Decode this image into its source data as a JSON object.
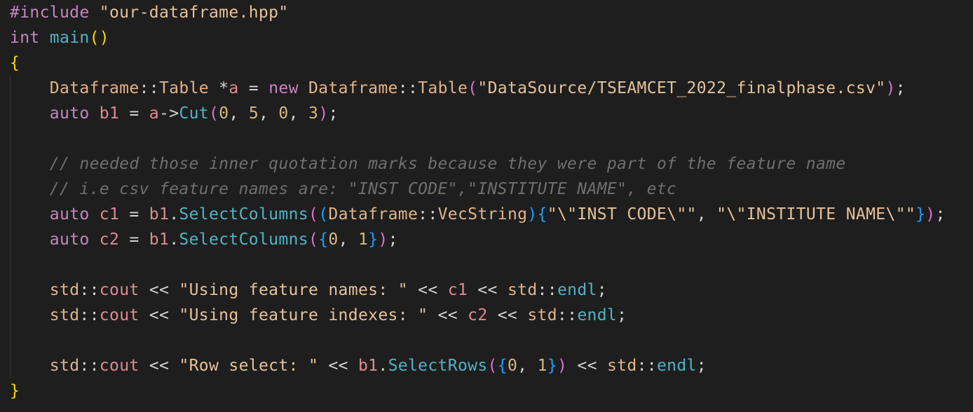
{
  "colors": {
    "background": "#1e1e1e",
    "default": "#d4d4d4",
    "keyword": "#c586c0",
    "type": "#4fb4c6",
    "function": "#4fb4c6",
    "string": "#e6c29a",
    "number": "#d7ba7d",
    "variable": "#e08a93",
    "comment": "#6f6f6f",
    "class": "#e2b387",
    "bracket1": "#ffd700",
    "bracket2": "#da70d6",
    "bracket3": "#179fff"
  },
  "lines": [
    [
      [
        "#include ",
        "keyword"
      ],
      [
        "\"our-dataframe.hpp\"",
        "string"
      ]
    ],
    [
      [
        "int ",
        "keyword"
      ],
      [
        "main",
        "function"
      ],
      [
        "()",
        "bracket1"
      ]
    ],
    [
      [
        "{",
        "bracket1"
      ]
    ],
    [
      [
        "    ",
        "default"
      ],
      [
        "Dataframe",
        "class"
      ],
      [
        "::",
        "default"
      ],
      [
        "Table",
        "class"
      ],
      [
        " *",
        "default"
      ],
      [
        "a",
        "variable"
      ],
      [
        " = ",
        "default"
      ],
      [
        "new ",
        "keyword"
      ],
      [
        "Dataframe",
        "class"
      ],
      [
        "::",
        "default"
      ],
      [
        "Table",
        "class"
      ],
      [
        "(",
        "bracket2"
      ],
      [
        "\"DataSource/TSEAMCET_2022_finalphase.csv\"",
        "string"
      ],
      [
        ")",
        "bracket2"
      ],
      [
        ";",
        "default"
      ]
    ],
    [
      [
        "    ",
        "default"
      ],
      [
        "auto ",
        "keyword"
      ],
      [
        "b1",
        "variable"
      ],
      [
        " = ",
        "default"
      ],
      [
        "a",
        "variable"
      ],
      [
        "->",
        "default"
      ],
      [
        "Cut",
        "function"
      ],
      [
        "(",
        "bracket2"
      ],
      [
        "0",
        "number"
      ],
      [
        ", ",
        "default"
      ],
      [
        "5",
        "number"
      ],
      [
        ", ",
        "default"
      ],
      [
        "0",
        "number"
      ],
      [
        ", ",
        "default"
      ],
      [
        "3",
        "number"
      ],
      [
        ")",
        "bracket2"
      ],
      [
        ";",
        "default"
      ]
    ],
    [],
    [
      [
        "    ",
        "default"
      ],
      [
        "// needed those inner quotation marks because they were part of the feature name",
        "comment"
      ]
    ],
    [
      [
        "    ",
        "default"
      ],
      [
        "// i.e csv feature names are: \"INST CODE\",\"INSTITUTE NAME\", etc",
        "comment"
      ]
    ],
    [
      [
        "    ",
        "default"
      ],
      [
        "auto ",
        "keyword"
      ],
      [
        "c1",
        "variable"
      ],
      [
        " = ",
        "default"
      ],
      [
        "b1",
        "variable"
      ],
      [
        ".",
        "default"
      ],
      [
        "SelectColumns",
        "function"
      ],
      [
        "(",
        "bracket2"
      ],
      [
        "(",
        "bracket3"
      ],
      [
        "Dataframe",
        "class"
      ],
      [
        "::",
        "default"
      ],
      [
        "VecString",
        "class"
      ],
      [
        ")",
        "bracket3"
      ],
      [
        "{",
        "bracket3"
      ],
      [
        "\"\\\"INST CODE\\\"\"",
        "string"
      ],
      [
        ", ",
        "default"
      ],
      [
        "\"\\\"INSTITUTE NAME\\\"\"",
        "string"
      ],
      [
        "}",
        "bracket3"
      ],
      [
        ")",
        "bracket2"
      ],
      [
        ";",
        "default"
      ]
    ],
    [
      [
        "    ",
        "default"
      ],
      [
        "auto ",
        "keyword"
      ],
      [
        "c2",
        "variable"
      ],
      [
        " = ",
        "default"
      ],
      [
        "b1",
        "variable"
      ],
      [
        ".",
        "default"
      ],
      [
        "SelectColumns",
        "function"
      ],
      [
        "(",
        "bracket2"
      ],
      [
        "{",
        "bracket3"
      ],
      [
        "0",
        "number"
      ],
      [
        ", ",
        "default"
      ],
      [
        "1",
        "number"
      ],
      [
        "}",
        "bracket3"
      ],
      [
        ")",
        "bracket2"
      ],
      [
        ";",
        "default"
      ]
    ],
    [],
    [
      [
        "    ",
        "default"
      ],
      [
        "std",
        "class"
      ],
      [
        "::",
        "default"
      ],
      [
        "cout",
        "variable"
      ],
      [
        " << ",
        "default"
      ],
      [
        "\"Using feature names: \"",
        "string"
      ],
      [
        " << ",
        "default"
      ],
      [
        "c1",
        "variable"
      ],
      [
        " << ",
        "default"
      ],
      [
        "std",
        "class"
      ],
      [
        "::",
        "default"
      ],
      [
        "endl",
        "function"
      ],
      [
        ";",
        "default"
      ]
    ],
    [
      [
        "    ",
        "default"
      ],
      [
        "std",
        "class"
      ],
      [
        "::",
        "default"
      ],
      [
        "cout",
        "variable"
      ],
      [
        " << ",
        "default"
      ],
      [
        "\"Using feature indexes: \"",
        "string"
      ],
      [
        " << ",
        "default"
      ],
      [
        "c2",
        "variable"
      ],
      [
        " << ",
        "default"
      ],
      [
        "std",
        "class"
      ],
      [
        "::",
        "default"
      ],
      [
        "endl",
        "function"
      ],
      [
        ";",
        "default"
      ]
    ],
    [],
    [
      [
        "    ",
        "default"
      ],
      [
        "std",
        "class"
      ],
      [
        "::",
        "default"
      ],
      [
        "cout",
        "variable"
      ],
      [
        " << ",
        "default"
      ],
      [
        "\"Row select: \"",
        "string"
      ],
      [
        " << ",
        "default"
      ],
      [
        "b1",
        "variable"
      ],
      [
        ".",
        "default"
      ],
      [
        "SelectRows",
        "function"
      ],
      [
        "(",
        "bracket2"
      ],
      [
        "{",
        "bracket3"
      ],
      [
        "0",
        "number"
      ],
      [
        ", ",
        "default"
      ],
      [
        "1",
        "number"
      ],
      [
        "}",
        "bracket3"
      ],
      [
        ")",
        "bracket2"
      ],
      [
        " << ",
        "default"
      ],
      [
        "std",
        "class"
      ],
      [
        "::",
        "default"
      ],
      [
        "endl",
        "function"
      ],
      [
        ";",
        "default"
      ]
    ],
    [
      [
        "}",
        "bracket1"
      ]
    ]
  ]
}
